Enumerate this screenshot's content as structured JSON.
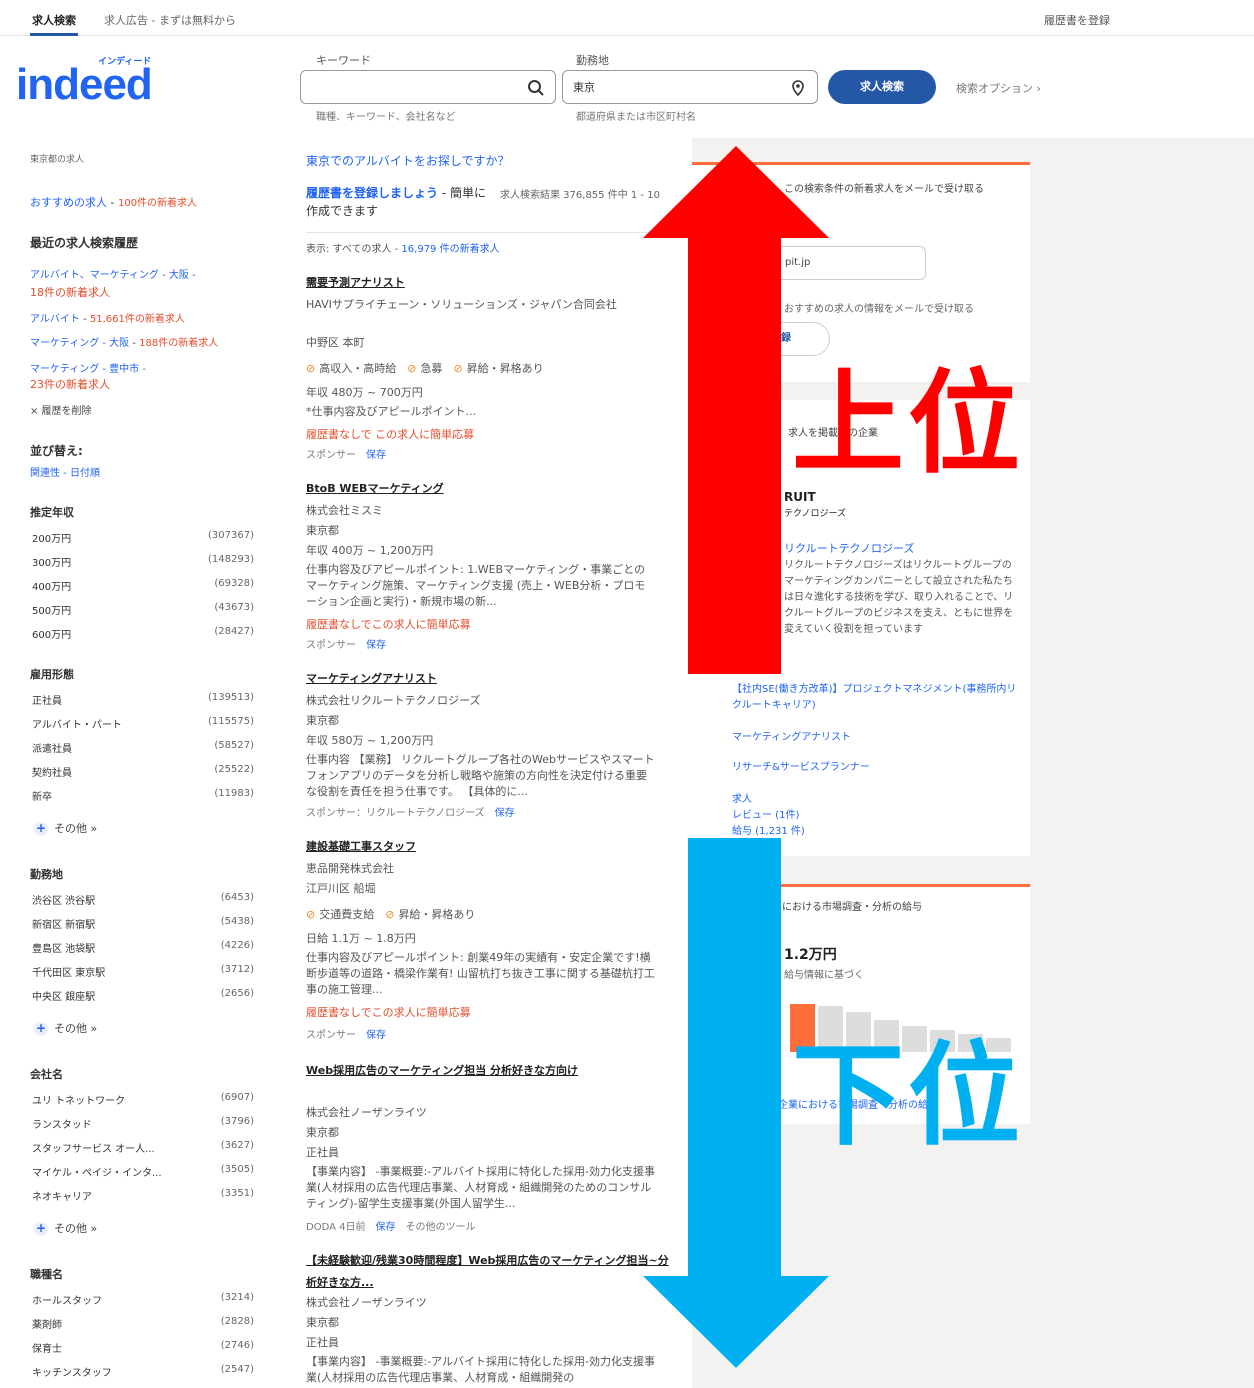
{
  "topnav": {
    "tab_search": "求人検索",
    "tab_ads": "求人広告 - まずは無料から",
    "signin": "履歴書を登録"
  },
  "logo": {
    "kana": "インディード",
    "word": "indeed"
  },
  "search": {
    "keyword_label": "キーワード",
    "keyword_value": "",
    "keyword_hint": "職種、キーワード、会社名など",
    "location_label": "勤務地",
    "location_value": "東京",
    "location_hint": "都道府県または市区町村名",
    "submit_label": "求人検索",
    "advanced_label": "検索オプション"
  },
  "sidebar": {
    "heading": "東京都の求人",
    "recommended": {
      "label": "おすすめの求人",
      "new": "100件の新着求人"
    },
    "history_title": "最近の求人検索履歴",
    "history": [
      {
        "label": "アルバイト、マーケティング - 大阪 -",
        "new": "18件の新着求人"
      },
      {
        "label": "アルバイト",
        "new": "51,661件の新着求人"
      },
      {
        "label": "マーケティング - 大阪",
        "new": "188件の新着求人"
      },
      {
        "label": "マーケティング - 豊中市 -",
        "new": "23件の新着求人"
      }
    ],
    "clear_history": "× 履歴を削除",
    "sort_title": "並び替え:",
    "sort_options": "関連性 - 日付順",
    "salary_title": "推定年収",
    "salary": [
      {
        "label": "200万円",
        "count": "(307367)"
      },
      {
        "label": "300万円",
        "count": "(148293)"
      },
      {
        "label": "400万円",
        "count": "(69328)"
      },
      {
        "label": "500万円",
        "count": "(43673)"
      },
      {
        "label": "600万円",
        "count": "(28427)"
      }
    ],
    "type_title": "雇用形態",
    "types": [
      {
        "label": "正社員",
        "count": "(139513)"
      },
      {
        "label": "アルバイト・パート",
        "count": "(115575)"
      },
      {
        "label": "派遣社員",
        "count": "(58527)"
      },
      {
        "label": "契約社員",
        "count": "(25522)"
      },
      {
        "label": "新卒",
        "count": "(11983)"
      }
    ],
    "more": "その他 »",
    "loc_title": "勤務地",
    "locations": [
      {
        "label": "渋谷区 渋谷駅",
        "count": "(6453)"
      },
      {
        "label": "新宿区 新宿駅",
        "count": "(5438)"
      },
      {
        "label": "豊島区 池袋駅",
        "count": "(4226)"
      },
      {
        "label": "千代田区 東京駅",
        "count": "(3712)"
      },
      {
        "label": "中央区 銀座駅",
        "count": "(2656)"
      }
    ],
    "company_title": "会社名",
    "companies": [
      {
        "label": "ユリ トネットワーク",
        "count": "(6907)"
      },
      {
        "label": "ランスタッド",
        "count": "(3796)"
      },
      {
        "label": "スタッフサービス オー人...",
        "count": "(3627)"
      },
      {
        "label": "マイケル・ペイジ・インタ...",
        "count": "(3505)"
      },
      {
        "label": "ネオキャリア",
        "count": "(3351)"
      }
    ],
    "job_title": "職種名",
    "jobs": [
      {
        "label": "ホールスタッフ",
        "count": "(3214)"
      },
      {
        "label": "薬剤師",
        "count": "(2828)"
      },
      {
        "label": "保育士",
        "count": "(2746)"
      },
      {
        "label": "キッチンスタッフ",
        "count": "(2547)"
      }
    ]
  },
  "results": {
    "prompt": "東京でのアルバイトをお探しですか？",
    "resume_cta": "履歴書を登録しましょう",
    "resume_cta2": " - 簡単に作成できます",
    "count": "求人検索結果 376,855 件中 1 - 10",
    "filter_prefix": "表示: すべての求人 - ",
    "filter_new": "16,979 件の新着求人",
    "jobs": [
      {
        "title": "需要予測アナリスト",
        "company": "HAVIサプライチェーン・ソリューションズ・ジャパン合同会社",
        "location": "中野区 本町",
        "tags": [
          "高収入・高時給",
          "急募",
          "昇給・昇格あり"
        ],
        "salary": "年収 480万 ~ 700万円",
        "desc": "*仕事内容及びアピールポイント...",
        "easy": "履歴書なしで この求人に簡単応募",
        "footer": "スポンサー",
        "save": "保存"
      },
      {
        "title": "BtoB WEBマーケティング",
        "company": "株式会社ミスミ",
        "location": "東京都",
        "salary": "年収 400万 ~ 1,200万円",
        "desc": "仕事内容及びアピールポイント: 1.WEBマーケティング・事業ごとのマーケティング施策、マーケティング支援 (売上・WEB分析・プロモーション企画と実行)・新規市場の新...",
        "easy": "履歴書なしでこの求人に簡単応募",
        "footer": "スポンサー",
        "save": "保存"
      },
      {
        "title": "マーケティングアナリスト",
        "company": "株式会社リクルートテクノロジーズ",
        "location": "東京都",
        "salary": "年収 580万 ~ 1,200万円",
        "desc": "仕事内容 【業務】 リクルートグループ各社のWebサービスやスマートフォンアプリのデータを分析し戦略や施策の方向性を決定付ける重要な役割を責任を担う仕事です。 【具体的に...",
        "footer": "スポンサー：リクルートテクノロジーズ",
        "save": "保存"
      },
      {
        "title": "建設基礎工事スタッフ",
        "company": "恵品開発株式会社",
        "location": "江戸川区 船堀",
        "tags": [
          "交通費支給",
          "昇給・昇格あり"
        ],
        "salary": "日給 1.1万 ~ 1.8万円",
        "desc": "仕事内容及びアピールポイント: 創業49年の実績有・安定企業です!横断歩道等の道路・橋梁作業有! 山留杭打ち抜き工事に関する基礎杭打工事の施工管理...",
        "easy": "履歴書なしでこの求人に簡単応募",
        "footer": "スポンサー",
        "save": "保存"
      },
      {
        "title": "Web採用広告のマーケティング担当 分析好きな方向け",
        "company": "株式会社ノーザンライツ",
        "location": "東京都",
        "type": "正社員",
        "desc": "【事業内容】 -事業概要:-アルバイト採用に特化した採用-効力化支援事業(人材採用の広告代理店事業、人材育成・組織開発のためのコンサルティング)-留学生支援事業(外国人留学生...",
        "footer": "DODA 4日前",
        "save": "保存",
        "tools": "その他のツール"
      },
      {
        "title": "【未経験歓迎/残業30時間程度】Web採用広告のマーケティング担当~分析好きな方...",
        "company": "株式会社ノーザンライツ",
        "location": "東京都",
        "type": "正社員",
        "desc": "【事業内容】 -事業概要:-アルバイト採用に特化した採用-効力化支援事業(人材採用の広告代理店事業、人材育成・組織開発の"
      }
    ]
  },
  "right": {
    "alert_title": "この検索条件の新着求人をメールで受け取る",
    "email_value": "pit.jp",
    "alert_note": "おすすめの求人の情報をメールで受け取る",
    "alert_button": "登録",
    "company_header": "求人を掲載中の企業",
    "brand_top": "RUIT",
    "brand_sub": "テクノロジーズ",
    "company_link": "リクルートテクノロジーズ",
    "company_desc": "リクルートテクノロジーズはリクルートグループのマーケティングカンパニーとして設立された私たちは日々進化する技術を学び、取り入れることで、リクルートグループのビジネスを支え、ともに世界を変えていく役割を担っています",
    "links": [
      "【社内SE(働き方改革)】プロジェクトマネジメント(事務所内リクルートキャリア)",
      "マーケティングアナリスト",
      "リサーチ&サービスプランナー"
    ],
    "meta": [
      "求人",
      "レビュー (1件)",
      "給与 (1,231 件)"
    ],
    "salary_header": "における市場調査・分析の給与",
    "salary_value": "1.2万円",
    "salary_note": "給与情報に基づく",
    "salary_footer": "企業における市場調査・分析の給与"
  },
  "overlay": {
    "up_label": "上位",
    "down_label": "下位",
    "up_color": "#ff0000",
    "down_color": "#00b0f0"
  }
}
